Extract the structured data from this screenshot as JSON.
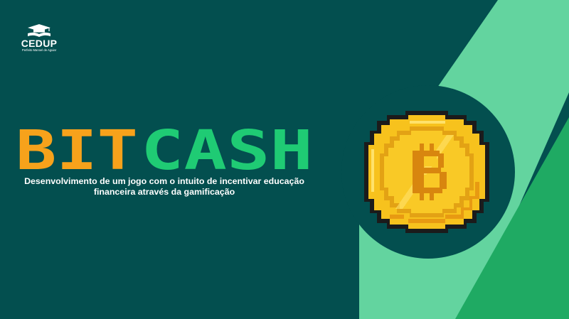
{
  "logo": {
    "name": "CEDUP",
    "subtitle": "Perfeito Manoel de Aguiar"
  },
  "title": {
    "part1": "BIT",
    "part2": "CASH"
  },
  "subtitle": {
    "line1": "Desenvolvimento de um jogo com o intuito de incentivar educação",
    "line2": "financeira através da gamificação"
  },
  "colors": {
    "background": "#034f4f",
    "accent_light": "#63d49f",
    "accent_dark": "#1faa63",
    "title_orange": "#f7a21b",
    "title_green": "#1fcb74",
    "coin_gold": "#f7c21d"
  },
  "icons": {
    "logo": "graduation-cap-book-icon",
    "coin": "bitcoin-coin-icon"
  }
}
